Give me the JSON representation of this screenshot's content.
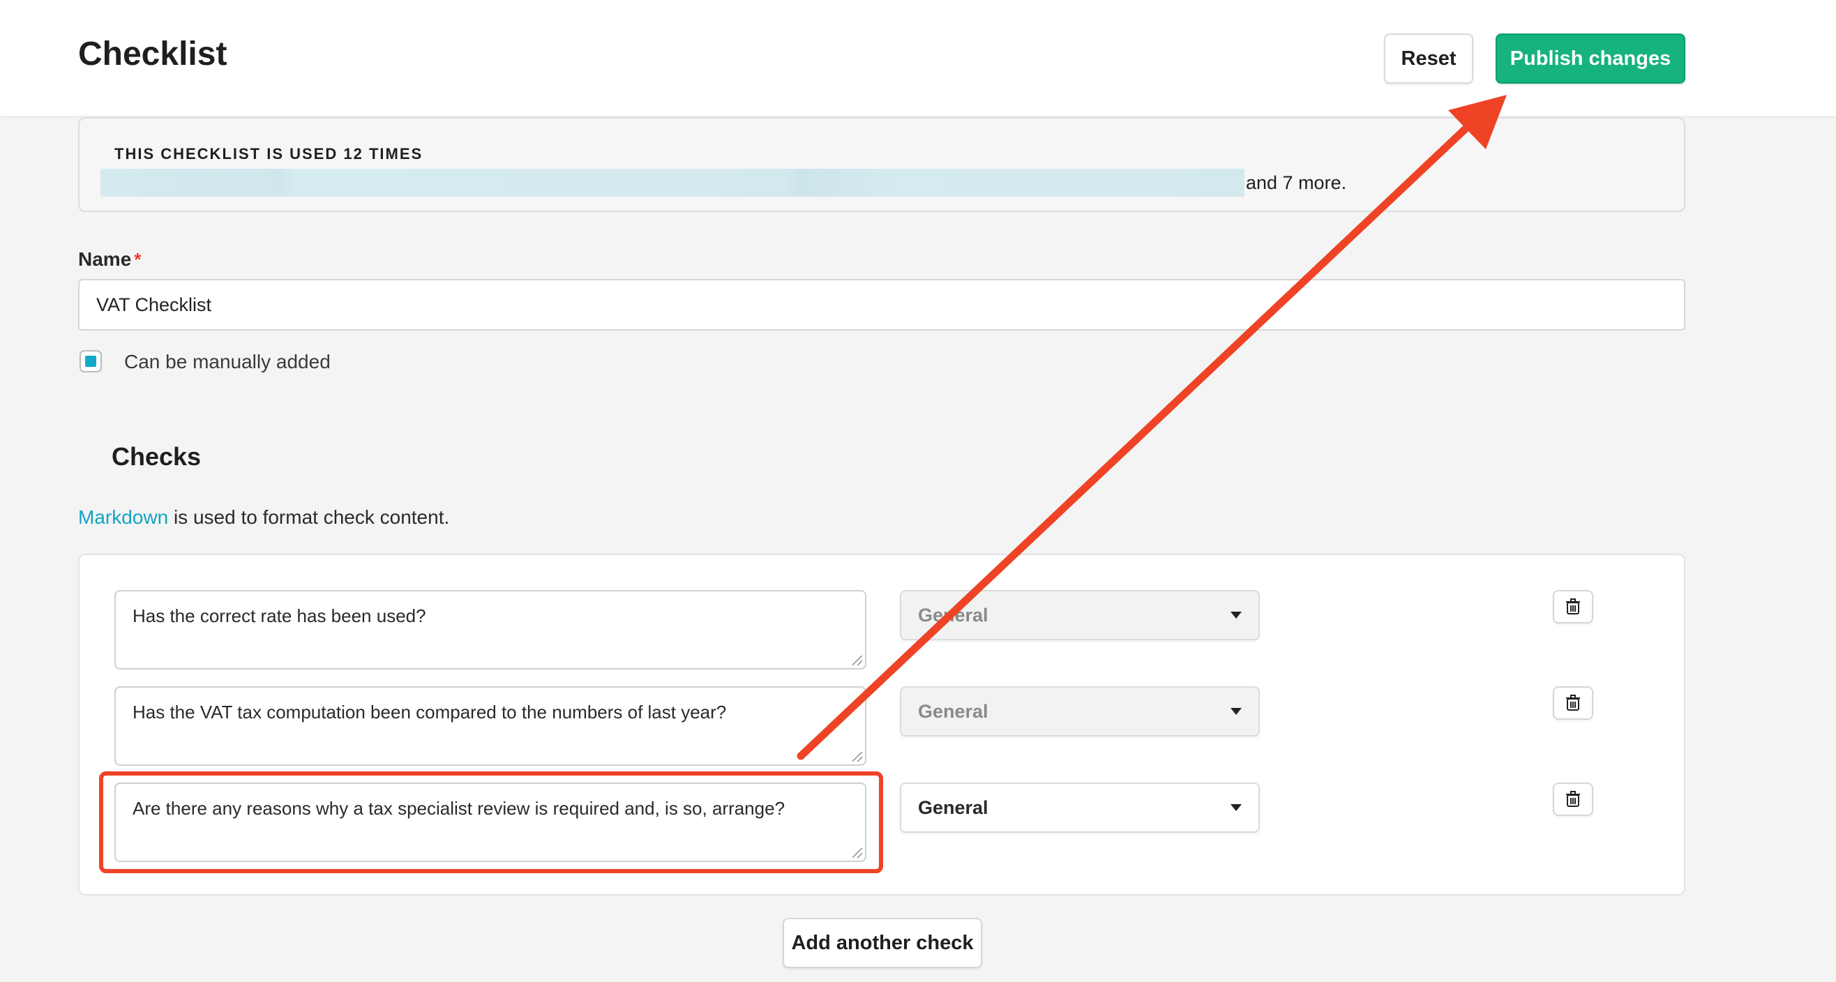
{
  "header": {
    "title": "Checklist",
    "reset_label": "Reset",
    "publish_label": "Publish changes"
  },
  "usage": {
    "heading": "THIS CHECKLIST IS USED 12 TIMES",
    "more_text": "and 7 more."
  },
  "form": {
    "name_label": "Name",
    "required_marker": "*",
    "name_value": "VAT Checklist",
    "manual_checkbox_label": "Can be manually added",
    "manual_checkbox_checked": true
  },
  "checks": {
    "title": "Checks",
    "markdown_link": "Markdown",
    "markdown_suffix": " is used to format check content.",
    "items": [
      {
        "text": "Has the correct rate has been used?",
        "category": "General",
        "category_disabled": true
      },
      {
        "text": "Has the VAT tax computation been compared to the numbers of last year?",
        "category": "General",
        "category_disabled": true
      },
      {
        "text": "Are there any reasons why a tax specialist review is required and, is so, arrange?",
        "category": "General",
        "category_disabled": false
      }
    ],
    "add_label": "Add another check"
  },
  "colors": {
    "accent_green": "#16b37c",
    "link_blue": "#12a4c4",
    "annotation_red": "#ef4326"
  }
}
